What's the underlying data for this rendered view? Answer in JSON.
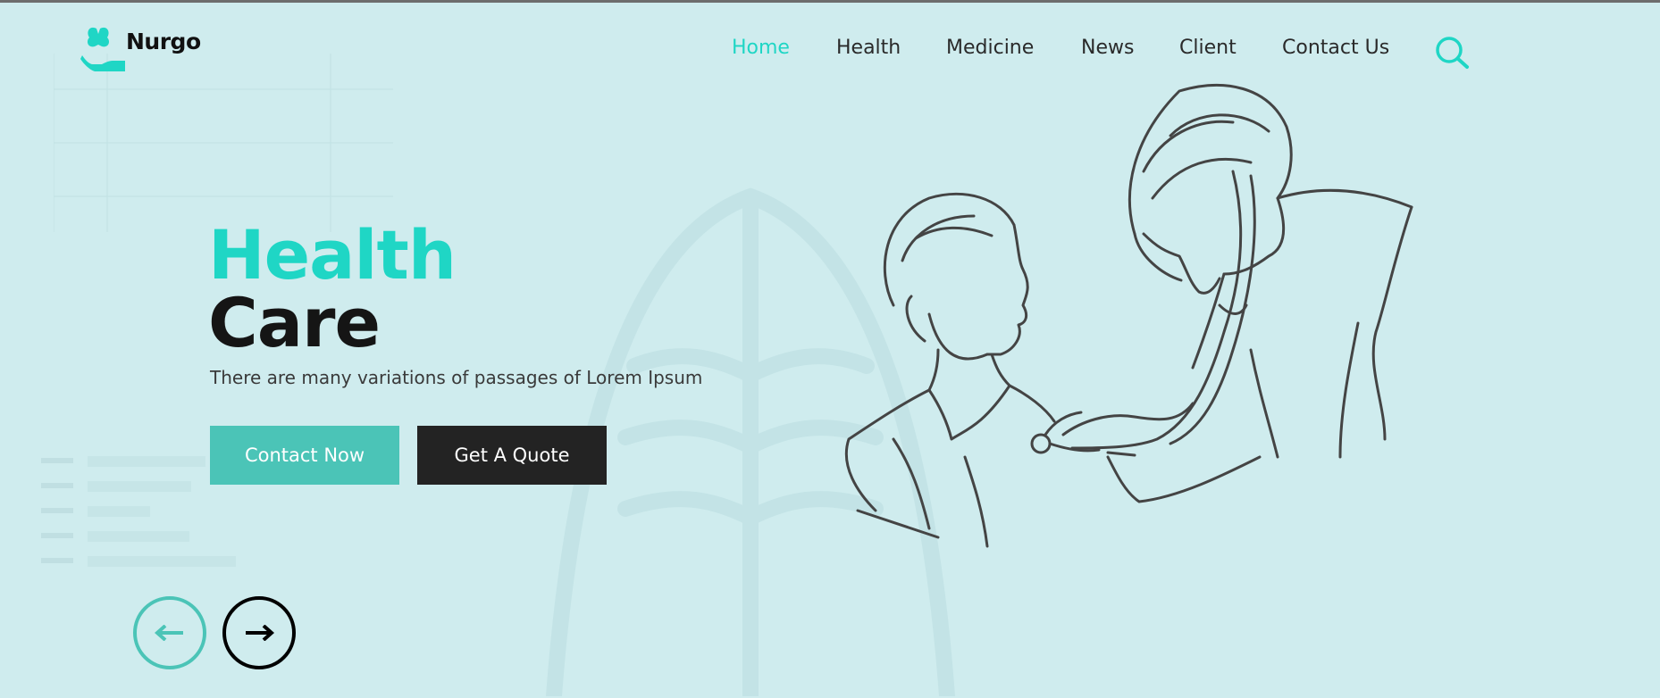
{
  "brand": {
    "name": "Nurgo",
    "logo_icon": "butterfly-hand-icon"
  },
  "nav": {
    "items": [
      {
        "label": "Home",
        "active": true
      },
      {
        "label": "Health",
        "active": false
      },
      {
        "label": "Medicine",
        "active": false
      },
      {
        "label": "News",
        "active": false
      },
      {
        "label": "Client",
        "active": false
      },
      {
        "label": "Contact Us",
        "active": false
      }
    ],
    "search_icon": "search-icon"
  },
  "hero": {
    "title_line1": "Health",
    "title_line2": "Care",
    "subtitle": "There are many variations of passages of Lorem Ipsum",
    "primary_button": "Contact Now",
    "secondary_button": "Get A Quote",
    "illustration": "doctor-examining-boy-with-stethoscope"
  },
  "slider": {
    "prev_icon": "arrow-left-icon",
    "next_icon": "arrow-right-icon"
  },
  "colors": {
    "background": "#cfecee",
    "accent": "#1fd6c5",
    "button_primary": "#4bc4b7",
    "button_dark": "#232323",
    "text_dark": "#151515"
  }
}
